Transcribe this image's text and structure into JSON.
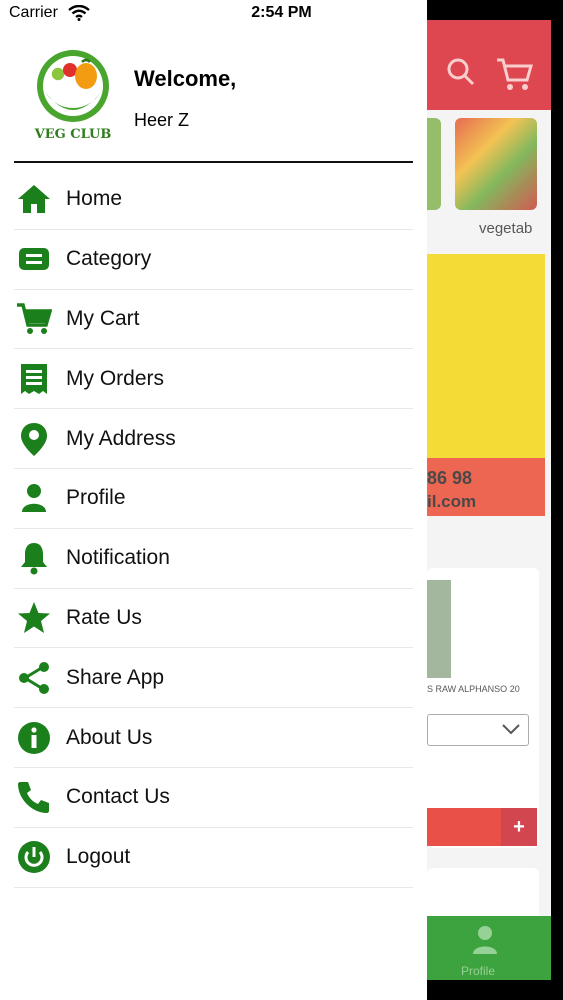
{
  "status_bar": {
    "carrier": "Carrier",
    "time": "2:54 PM"
  },
  "drawer": {
    "logo_text": "VEG CLUB",
    "welcome": "Welcome,",
    "username": "Heer Z",
    "menu_items": [
      {
        "label": "Home",
        "icon": "home-icon"
      },
      {
        "label": "Category",
        "icon": "category-icon"
      },
      {
        "label": "My Cart",
        "icon": "cart-icon"
      },
      {
        "label": "My Orders",
        "icon": "orders-icon"
      },
      {
        "label": "My Address",
        "icon": "location-pin-icon"
      },
      {
        "label": "Profile",
        "icon": "person-icon"
      },
      {
        "label": "Notification",
        "icon": "bell-icon"
      },
      {
        "label": "Rate Us",
        "icon": "star-icon"
      },
      {
        "label": "Share App",
        "icon": "share-icon"
      },
      {
        "label": "About Us",
        "icon": "info-icon"
      },
      {
        "label": "Contact Us",
        "icon": "phone-icon"
      },
      {
        "label": "Logout",
        "icon": "power-icon"
      }
    ]
  },
  "background": {
    "category_label": "vegetab",
    "banner_phone": "86 98",
    "banner_email": "il.com",
    "product_name": "S RAW ALPHANSO 20",
    "add_symbol": "+",
    "tab_profile": "Profile"
  },
  "colors": {
    "accent_green": "#1b7f1b",
    "header_red": "#d81f2a",
    "banner_yellow": "#f2d40a"
  }
}
